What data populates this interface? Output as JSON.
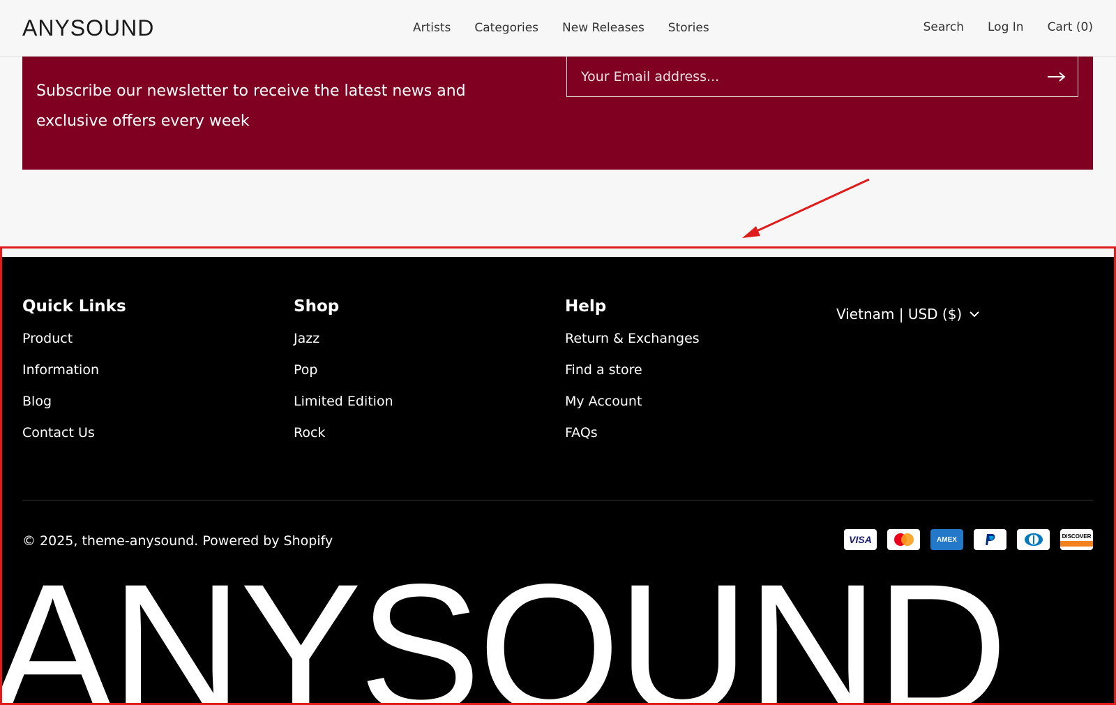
{
  "header": {
    "logo": "ANYSOUND",
    "nav": [
      "Artists",
      "Categories",
      "New Releases",
      "Stories"
    ],
    "actions": {
      "search": "Search",
      "login": "Log In",
      "cart": "Cart (0)"
    }
  },
  "newsletter": {
    "text": "Subscribe our newsletter to receive the latest news and exclusive offers every week",
    "email_placeholder": "Your Email address...",
    "background_color": "#7f0020"
  },
  "footer": {
    "columns": [
      {
        "title": "Quick Links",
        "links": [
          "Product",
          "Information",
          "Blog",
          "Contact Us"
        ]
      },
      {
        "title": "Shop",
        "links": [
          "Jazz",
          "Pop",
          "Limited Edition",
          "Rock"
        ]
      },
      {
        "title": "Help",
        "links": [
          "Return & Exchanges",
          "Find a store",
          "My Account",
          "FAQs"
        ]
      }
    ],
    "locale": "Vietnam | USD ($)",
    "copyright": "© 2025, theme-anysound. Powered by Shopify",
    "payments": [
      {
        "name": "VISA",
        "icon": "visa-icon"
      },
      {
        "name": "Mastercard",
        "icon": "mastercard-icon"
      },
      {
        "name": "AMEX",
        "icon": "amex-icon"
      },
      {
        "name": "PayPal",
        "icon": "paypal-icon"
      },
      {
        "name": "Diners Club",
        "icon": "diners-icon"
      },
      {
        "name": "DISCOVER",
        "icon": "discover-icon"
      }
    ],
    "big_logo": "ANYSOUND"
  },
  "annotation": {
    "color": "#e01b1b"
  }
}
